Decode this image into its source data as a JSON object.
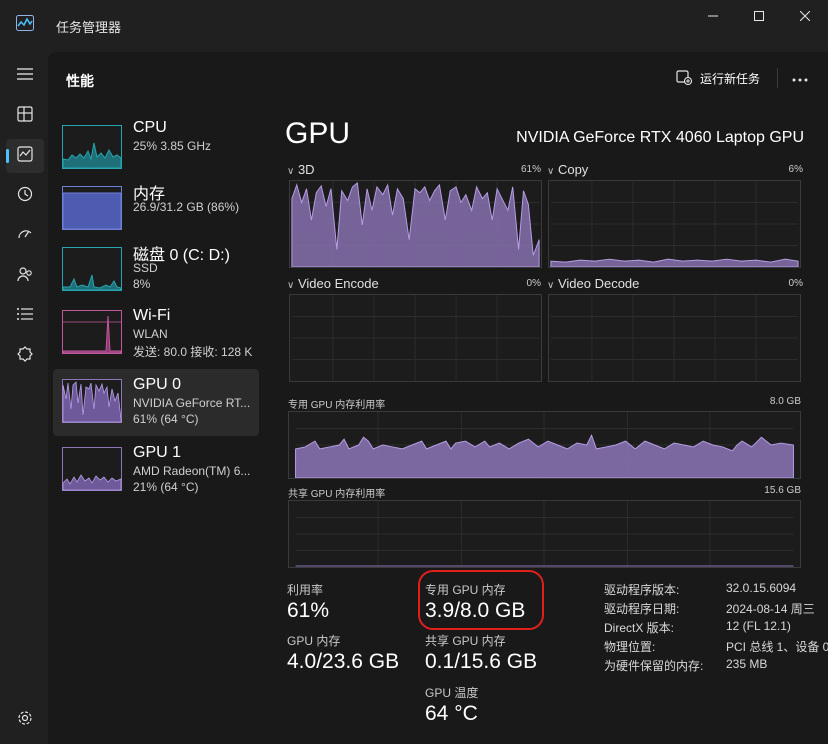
{
  "window": {
    "title": "任务管理器"
  },
  "header": {
    "title": "性能",
    "run_task_label": "运行新任务"
  },
  "nav": [
    "hamburger-icon",
    "processes-icon",
    "performance-icon",
    "app-history-icon",
    "startup-icon",
    "users-icon",
    "details-icon",
    "services-icon",
    "settings-icon"
  ],
  "resources": [
    {
      "name": "CPU",
      "sub1": "25%  3.85 GHz",
      "sub2": "",
      "sub3": ""
    },
    {
      "name": "内存",
      "sub1": "26.9/31.2 GB (86%)",
      "sub2": "",
      "sub3": ""
    },
    {
      "name": "磁盘 0 (C: D:)",
      "sub1": "SSD",
      "sub2": "8%",
      "sub3": ""
    },
    {
      "name": "Wi-Fi",
      "sub1": "WLAN",
      "sub2": "发送: 80.0  接收: 128 K",
      "sub3": ""
    },
    {
      "name": "GPU 0",
      "sub1": "NVIDIA GeForce RT...",
      "sub2": "61% (64 °C)",
      "sub3": ""
    },
    {
      "name": "GPU 1",
      "sub1": "AMD Radeon(TM) 6...",
      "sub2": "21% (64 °C)",
      "sub3": ""
    }
  ],
  "gpu": {
    "title": "GPU",
    "model": "NVIDIA GeForce RTX 4060 Laptop GPU",
    "engines": [
      {
        "label": "3D",
        "percent": "61%"
      },
      {
        "label": "Copy",
        "percent": "6%"
      },
      {
        "label": "Video Encode",
        "percent": "0%"
      },
      {
        "label": "Video Decode",
        "percent": "0%"
      }
    ],
    "dedicated_graph": {
      "label": "专用 GPU 内存利用率",
      "max": "8.0 GB"
    },
    "shared_graph": {
      "label": "共享 GPU 内存利用率",
      "max": "15.6 GB"
    }
  },
  "stats": {
    "utilization": {
      "label": "利用率",
      "value": "61%"
    },
    "dedicated": {
      "label": "专用 GPU 内存",
      "value": "3.9/8.0 GB"
    },
    "gpu_memory": {
      "label": "GPU 内存",
      "value": "4.0/23.6 GB"
    },
    "shared": {
      "label": "共享 GPU 内存",
      "value": "0.1/15.6 GB"
    },
    "temperature": {
      "label": "GPU 温度",
      "value": "64 °C"
    }
  },
  "info": [
    {
      "key": "驱动程序版本:",
      "value": "32.0.15.6094"
    },
    {
      "key": "驱动程序日期:",
      "value": "2024-08-14 周三"
    },
    {
      "key": "DirectX 版本:",
      "value": "12 (FL 12.1)"
    },
    {
      "key": "物理位置:",
      "value": "PCI 总线 1、设备 0、..."
    },
    {
      "key": "为硬件保留的内存:",
      "value": "235 MB"
    }
  ],
  "colors": {
    "gpu_fill": "#8d75b8",
    "gpu_line": "#b79ee6",
    "cpu": "#25a5b0",
    "memory": "#6f7fd6",
    "wifi": "#c0569b",
    "highlight": "#e0201b",
    "accent": "#4cc2ff"
  }
}
